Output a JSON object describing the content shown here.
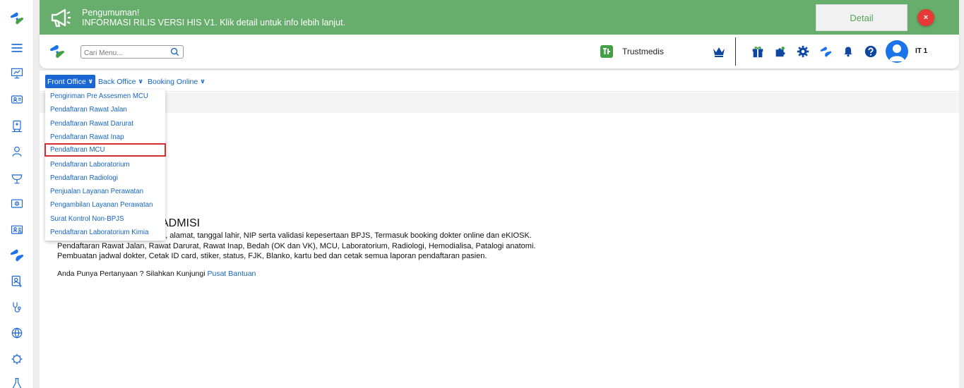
{
  "announcement": {
    "title": "Pengumuman!",
    "message": "INFORMASI RILIS VERSI HIS V1. Klik detail untuk info lebih lanjut.",
    "detail_label": "Detail",
    "close_label": "×"
  },
  "header": {
    "search_placeholder": "Cari Menu...",
    "brand_name": "Trustmedis",
    "user_name": "IT 1"
  },
  "topmenu": {
    "items": [
      {
        "label": "Front Office"
      },
      {
        "label": "Back Office"
      },
      {
        "label": "Booking Online"
      }
    ]
  },
  "dropdown": {
    "items": [
      {
        "label": "Pengiriman Pre Assesmen MCU"
      },
      {
        "label": "Pendaftaran Rawat Jalan"
      },
      {
        "label": "Pendaftaran Rawat Darurat"
      },
      {
        "label": "Pendaftaran Rawat Inap"
      },
      {
        "label": "Pendaftaran MCU"
      },
      {
        "label": "Pendaftaran Laboratorium"
      },
      {
        "label": "Pendaftaran Radiologi"
      },
      {
        "label": "Penjualan Layanan Perawatan"
      },
      {
        "label": "Pengambilan Layanan Perawatan"
      },
      {
        "label": "Surat Kontrol Non-BPJS"
      },
      {
        "label": "Pendaftaran Laboratorium Kimia"
      }
    ]
  },
  "content": {
    "section_title": "ADMISI",
    "line1": "a, alamat, tanggal lahir, NIP serta validasi kepesertaan BPJS, Termasuk booking dokter online dan eKIOSK.",
    "line2": "Pendaftaran Rawat Jalan, Rawat Darurat, Rawat Inap, Bedah (OK dan VK), MCU, Laboratorium, Radiologi, Hemodialisa, Patalogi anatomi.",
    "line3": "Pembuatan jadwal dokter, Cetak ID card, stiker, status, FJK, Blanko, kartu bed dan cetak semua laporan pendaftaran pasien.",
    "help_text": "Anda Punya Pertanyaan ? Silahkan Kunjungi",
    "help_link": "Pusat Bantuan"
  },
  "colors": {
    "announce_bg": "#67ad6b",
    "brand_blue": "#1a66d2",
    "link_blue": "#1565c0",
    "highlight_red": "#d32f2f"
  },
  "icons": [
    "trustmedis-logo",
    "menu-icon",
    "presentation-icon",
    "id-card-icon",
    "doctor-icon",
    "patient-icon",
    "pharmacy-icon",
    "finance-icon",
    "report-icon",
    "megaphone-icon",
    "search-icon",
    "crown-icon",
    "gift-icon",
    "puzzle-icon",
    "gear-icon",
    "bell-icon",
    "help-icon",
    "avatar-icon"
  ]
}
